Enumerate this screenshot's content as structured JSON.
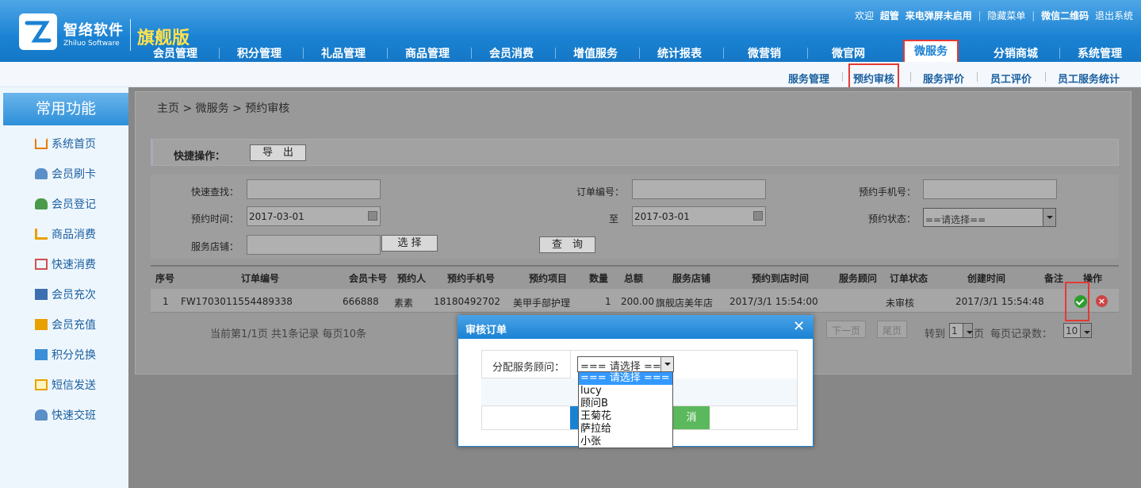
{
  "brand": {
    "name": "智络软件",
    "en": "Zhiluo Software",
    "edition": "旗舰版"
  },
  "topbar": {
    "welcome": "欢迎",
    "user": "超管",
    "call": "来电弹屏未启用",
    "hide": "隐藏菜单",
    "qr": "微信二维码",
    "logout": "退出系统",
    "sep": "|"
  },
  "nav": [
    "会员管理",
    "积分管理",
    "礼品管理",
    "商品管理",
    "会员消费",
    "增值服务",
    "统计报表",
    "微营销",
    "微官网",
    "微服务",
    "分销商城",
    "系统管理"
  ],
  "subnav": [
    "服务管理",
    "预约审核",
    "服务评价",
    "员工评价",
    "员工服务统计"
  ],
  "sidebar": {
    "title": "常用功能",
    "items": [
      "系统首页",
      "会员刷卡",
      "会员登记",
      "商品消费",
      "快速消费",
      "会员充次",
      "会员充值",
      "积分兑换",
      "短信发送",
      "快速交班"
    ]
  },
  "breadcrumb": "主页 > 微服务 > 预约审核",
  "quick": {
    "label": "快捷操作：",
    "export": "导　出"
  },
  "form": {
    "search": "快速查找：",
    "order_no": "订单编号：",
    "phone": "预约手机号：",
    "time": "预约时间：",
    "from": "2017-03-01",
    "to_label": "至",
    "to": "2017-03-01",
    "status": "预约状态：",
    "status_val": "==请选择==",
    "store": "服务店铺：",
    "select": "选 择",
    "query": "查　询"
  },
  "table": {
    "headers": [
      "序号",
      "订单编号",
      "会员卡号",
      "预约人",
      "预约手机号",
      "预约项目",
      "数量",
      "总额",
      "服务店铺",
      "预约到店时间",
      "服务顾问",
      "订单状态",
      "创建时间",
      "备注",
      "操作"
    ],
    "rows": [
      [
        "1",
        "FW1703011554489338",
        "666888",
        "素素",
        "18180492702",
        "美甲手部护理",
        "1",
        "200.00",
        "旗舰店美年店",
        "2017/3/1 15:54:00",
        "",
        "未审核",
        "2017/3/1 15:54:48",
        ""
      ]
    ]
  },
  "pager": {
    "info": "当前第1/1页 共1条记录 每页10条",
    "next": "下一页",
    "last": "尾页",
    "goto": "转到",
    "page": "1",
    "page_suffix": "页",
    "per": "每页记录数：",
    "per_val": "10"
  },
  "dialog": {
    "title": "审核订单",
    "close": "✕",
    "label": "分配服务顾问：",
    "selected": "=== 请选择 ===",
    "options": [
      "=== 请选择 ===",
      "lucy",
      "顾问B",
      "王菊花",
      "萨拉给",
      "小张"
    ],
    "cancel": "消"
  }
}
